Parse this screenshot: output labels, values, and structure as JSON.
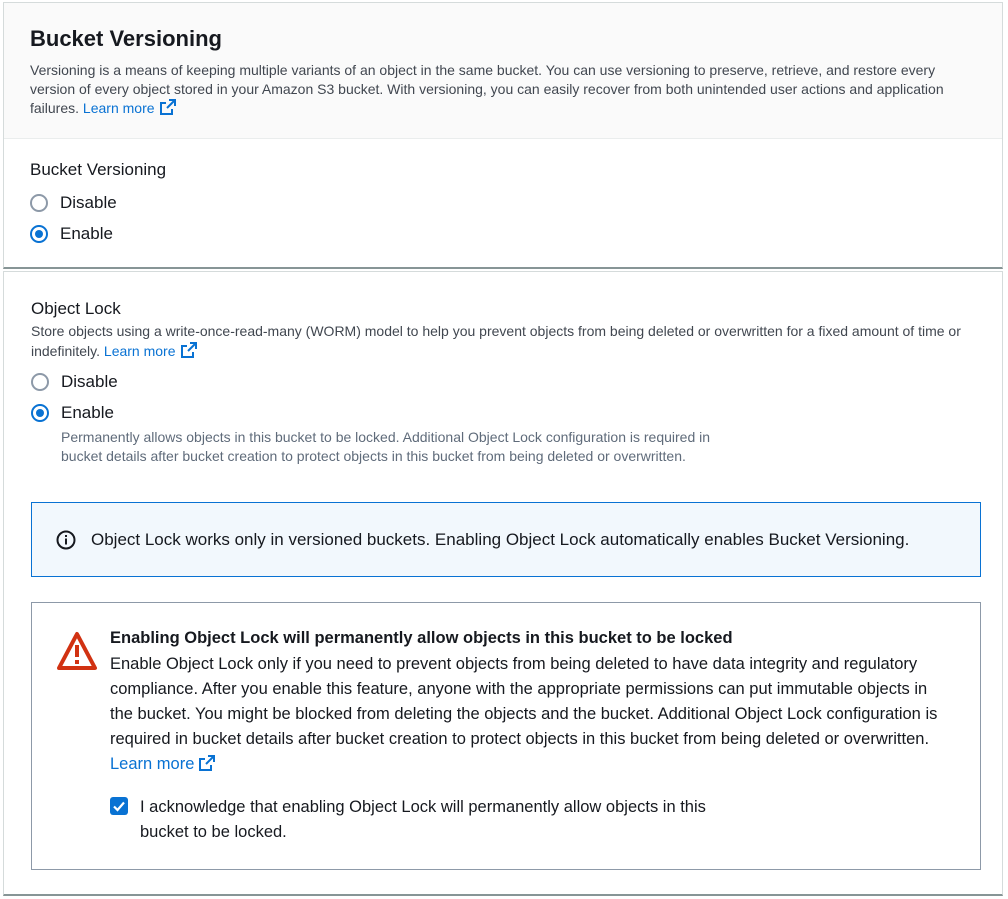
{
  "versioning": {
    "title": "Bucket Versioning",
    "description": "Versioning is a means of keeping multiple variants of an object in the same bucket. You can use versioning to preserve, retrieve, and restore every version of every object stored in your Amazon S3 bucket. With versioning, you can easily recover from both unintended user actions and application failures.",
    "learn_more": "Learn more",
    "field_label": "Bucket Versioning",
    "options": [
      {
        "label": "Disable",
        "selected": false
      },
      {
        "label": "Enable",
        "selected": true
      }
    ]
  },
  "object_lock": {
    "label": "Object Lock",
    "description": "Store objects using a write-once-read-many (WORM) model to help you prevent objects from being deleted or overwritten for a fixed amount of time or indefinitely.",
    "learn_more": "Learn more",
    "options": [
      {
        "label": "Disable",
        "selected": false
      },
      {
        "label": "Enable",
        "selected": true,
        "description": "Permanently allows objects in this bucket to be locked. Additional Object Lock configuration is required in bucket details after bucket creation to protect objects in this bucket from being deleted or overwritten."
      }
    ],
    "info": "Object Lock works only in versioned buckets. Enabling Object Lock automatically enables Bucket Versioning.",
    "warning": {
      "title": "Enabling Object Lock will permanently allow objects in this bucket to be locked",
      "text": "Enable Object Lock only if you need to prevent objects from being deleted to have data integrity and regulatory compliance. After you enable this feature, anyone with the appropriate permissions can put immutable objects in the bucket. You might be blocked from deleting the objects and the bucket. Additional Object Lock configuration is required in bucket details after bucket creation to protect objects in this bucket from being deleted or overwritten.",
      "learn_more": "Learn more",
      "acknowledge": "I acknowledge that enabling Object Lock will permanently allow objects in this bucket to be locked.",
      "acknowledged": true
    }
  },
  "colors": {
    "link": "#0972d3",
    "warning": "#d13212",
    "info_border": "#0972d3"
  },
  "icons": {
    "external": "external-link-icon",
    "info": "info-icon",
    "warning": "warning-icon",
    "check": "check-icon"
  }
}
